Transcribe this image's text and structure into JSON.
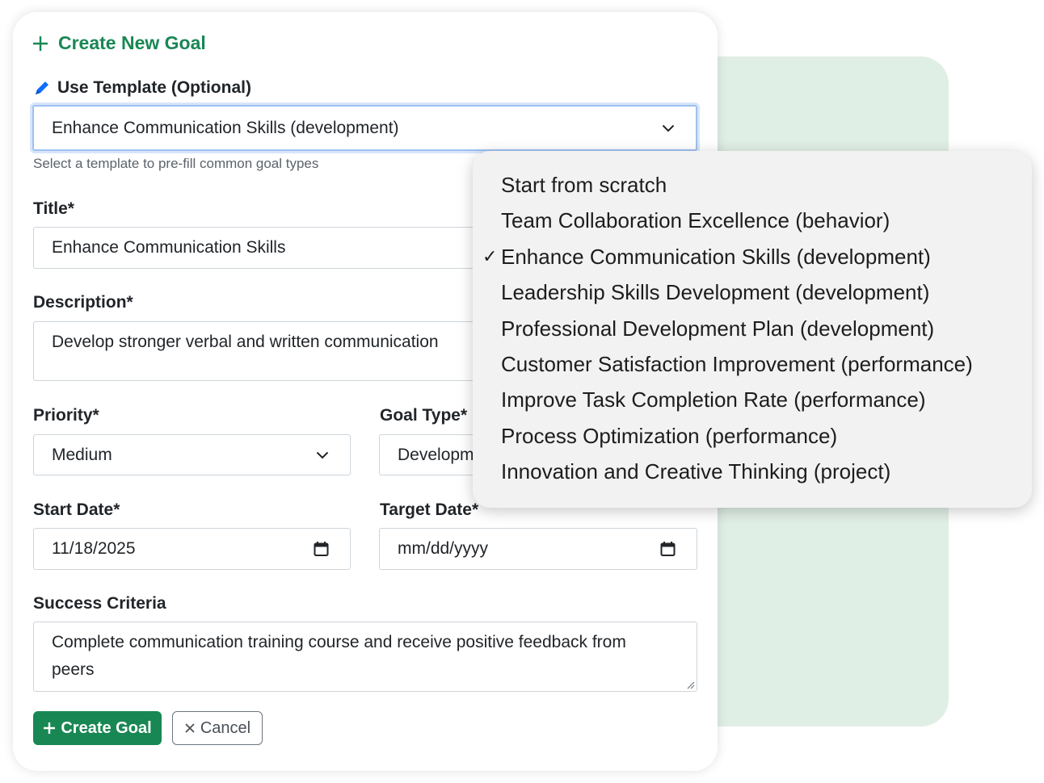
{
  "form": {
    "title": "Create New Goal",
    "template": {
      "label": "Use Template (Optional)",
      "value": "Enhance Communication Skills (development)",
      "help": "Select a template to pre-fill common goal types"
    },
    "title_field": {
      "label": "Title*",
      "value": "Enhance Communication Skills"
    },
    "description": {
      "label": "Description*",
      "value": "Develop stronger verbal and written communication"
    },
    "priority": {
      "label": "Priority*",
      "value": "Medium"
    },
    "goal_type": {
      "label": "Goal Type*",
      "value": "Developm"
    },
    "start_date": {
      "label": "Start Date*",
      "value": "11/18/2025"
    },
    "target_date": {
      "label": "Target Date*",
      "value": "mm/dd/yyyy"
    },
    "success_criteria": {
      "label": "Success Criteria",
      "value": "Complete communication training course and receive positive feedback from peers"
    },
    "create_button": "Create Goal",
    "cancel_button": "Cancel"
  },
  "dropdown": {
    "options": [
      {
        "label": "Start from scratch",
        "selected": false
      },
      {
        "label": "Team Collaboration Excellence (behavior)",
        "selected": false
      },
      {
        "label": "Enhance Communication Skills (development)",
        "selected": true
      },
      {
        "label": "Leadership Skills Development (development)",
        "selected": false
      },
      {
        "label": "Professional Development Plan (development)",
        "selected": false
      },
      {
        "label": "Customer Satisfaction Improvement (performance)",
        "selected": false
      },
      {
        "label": "Improve Task Completion Rate (performance)",
        "selected": false
      },
      {
        "label": "Process Optimization (performance)",
        "selected": false
      },
      {
        "label": "Innovation and Creative Thinking (project)",
        "selected": false
      }
    ],
    "check_glyph": "✓"
  },
  "colors": {
    "accent": "#198754",
    "panel_bg": "#e0efe6",
    "pencil": "#0d6efd"
  },
  "icons": {
    "title": "plus-icon",
    "template_label": "pencil-icon",
    "select": "chevron-down-icon",
    "date": "calendar-icon",
    "create": "plus-icon",
    "cancel": "close-icon"
  }
}
